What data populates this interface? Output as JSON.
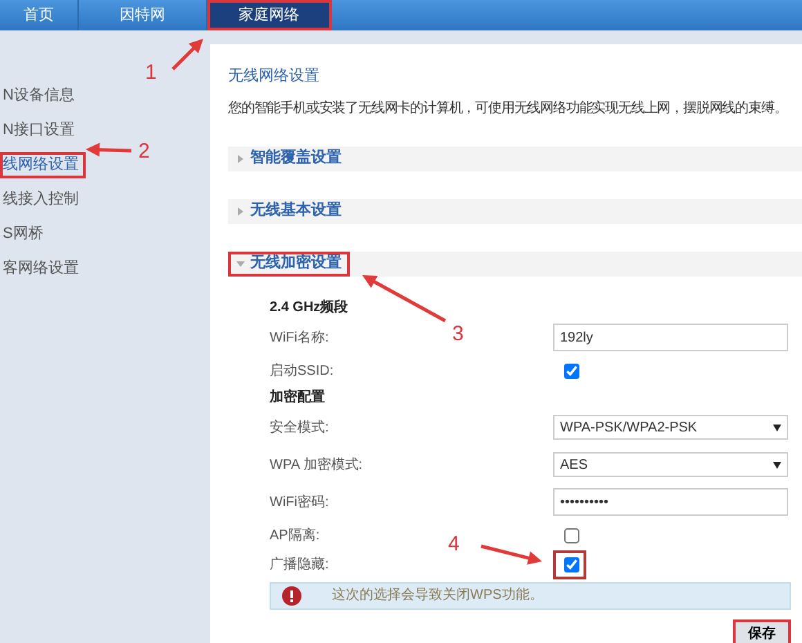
{
  "nav_tabs": [
    {
      "label": "首页",
      "selected": false,
      "highlighted": false
    },
    {
      "label": "因特网",
      "selected": false,
      "highlighted": false
    },
    {
      "label": "家庭网络",
      "selected": true,
      "highlighted": true
    }
  ],
  "sidebar": {
    "items": [
      {
        "label": "N设备信息",
        "selected": false,
        "highlighted": false
      },
      {
        "label": "N接口设置",
        "selected": false,
        "highlighted": false
      },
      {
        "label": "线网络设置",
        "selected": true,
        "highlighted": true
      },
      {
        "label": "线接入控制",
        "selected": false,
        "highlighted": false
      },
      {
        "label": "S网桥",
        "selected": false,
        "highlighted": false
      },
      {
        "label": "客网络设置",
        "selected": false,
        "highlighted": false
      }
    ]
  },
  "content": {
    "title": "无线网络设置",
    "description": "您的智能手机或安装了无线网卡的计算机，可使用无线网络功能实现无线上网，摆脱网线的束缚。",
    "sections": [
      {
        "title": "智能覆盖设置",
        "expanded": false,
        "highlighted": false
      },
      {
        "title": "无线基本设置",
        "expanded": false,
        "highlighted": false
      },
      {
        "title": "无线加密设置",
        "expanded": true,
        "highlighted": true
      }
    ]
  },
  "form": {
    "rows": [
      {
        "kind": "heading",
        "label": "2.4 GHz频段"
      },
      {
        "kind": "text",
        "label": "WiFi名称:",
        "value": "192ly"
      },
      {
        "kind": "checkbox",
        "label": "启动SSID:",
        "checked": true,
        "highlighted": false
      },
      {
        "kind": "heading",
        "label": "加密配置"
      },
      {
        "kind": "select",
        "label": "安全模式:",
        "value": "WPA-PSK/WPA2-PSK"
      },
      {
        "kind": "select",
        "label": "WPA 加密模式:",
        "value": "AES"
      },
      {
        "kind": "text",
        "label": "WiFi密码:",
        "value": "••••••••••"
      },
      {
        "kind": "checkbox",
        "label": "AP隔离:",
        "checked": false,
        "highlighted": false
      },
      {
        "kind": "checkbox",
        "label": "广播隐藏:",
        "checked": true,
        "highlighted": true
      }
    ],
    "warning": "这次的选择会导致关闭WPS功能。",
    "save_button": {
      "label": "保存",
      "highlighted": true
    }
  },
  "annotations": [
    {
      "number": "1"
    },
    {
      "number": "2"
    },
    {
      "number": "3"
    },
    {
      "number": "4"
    }
  ]
}
